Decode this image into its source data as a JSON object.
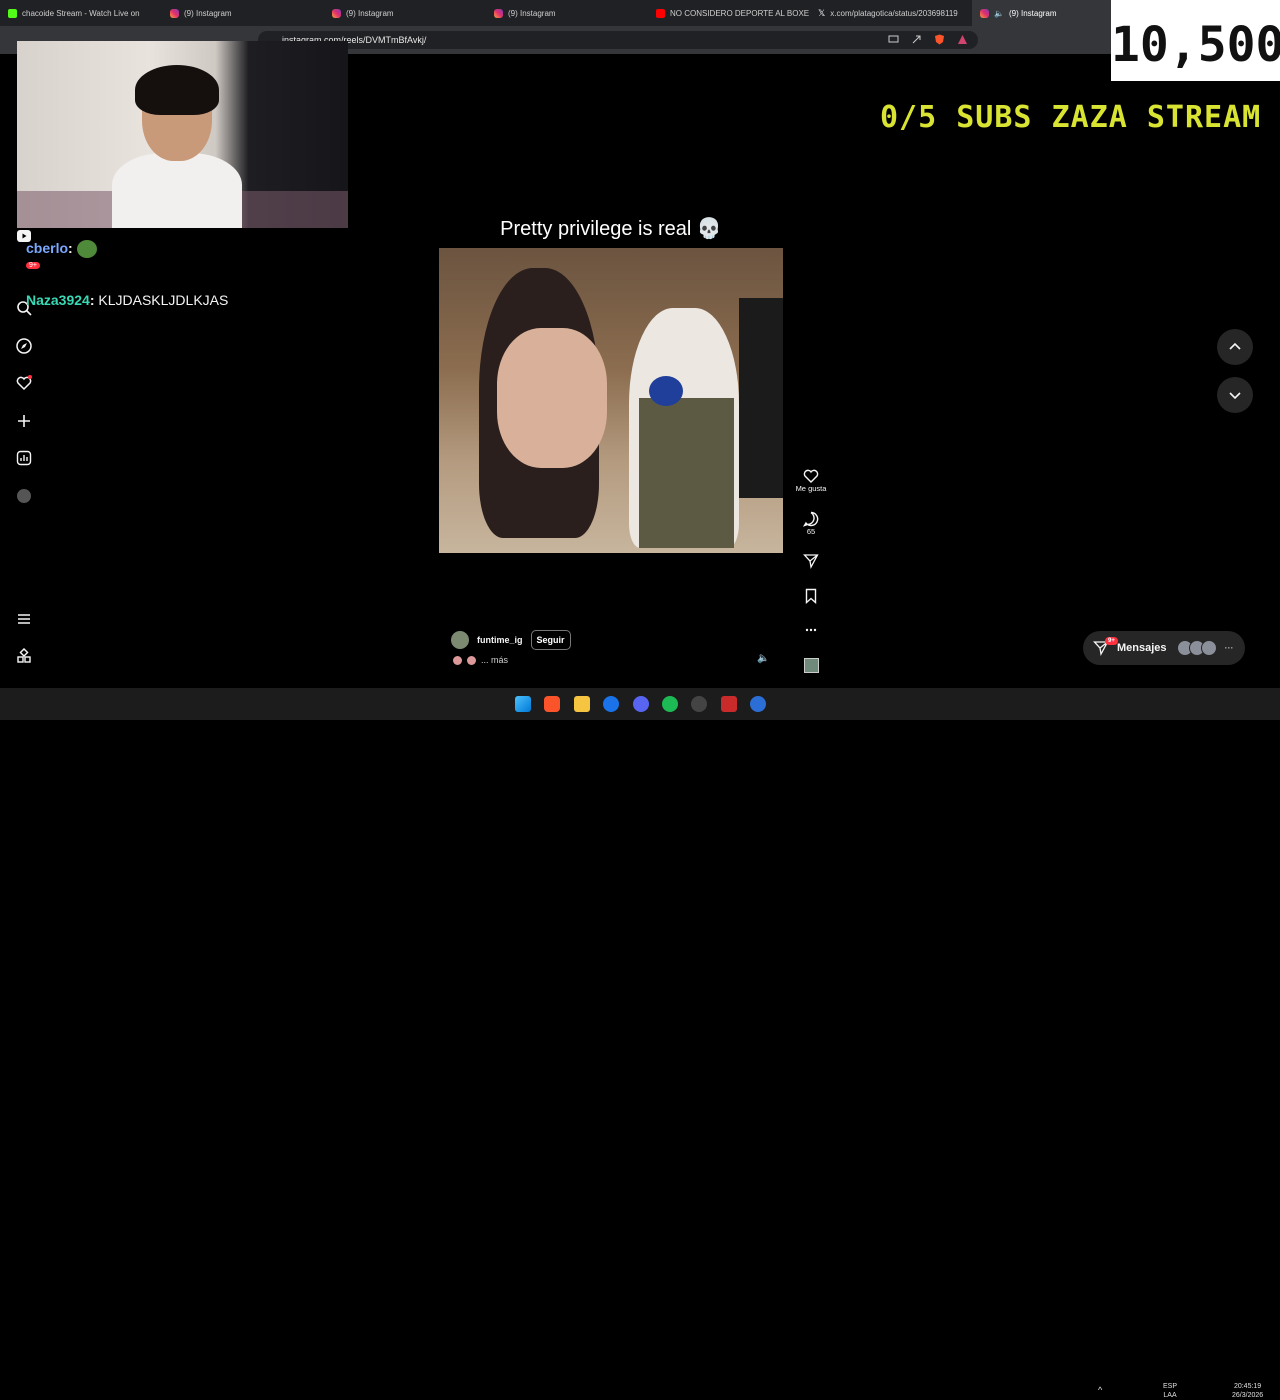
{
  "browser": {
    "tabs": [
      {
        "label": "chacoide Stream - Watch Live on",
        "icon": "kick-icon"
      },
      {
        "label": "(9) Instagram",
        "icon": "instagram-icon"
      },
      {
        "label": "(9) Instagram",
        "icon": "instagram-icon"
      },
      {
        "label": "(9) Instagram",
        "icon": "instagram-icon"
      },
      {
        "label": "NO CONSIDERO DEPORTE AL BOXE",
        "icon": "youtube-icon"
      },
      {
        "label": "x.com/platagotica/status/203698119",
        "icon": "x-icon"
      },
      {
        "label": "(9) Instagram",
        "icon": "instagram-icon"
      }
    ],
    "url": "instagram.com/reels/DVMTmBfAvkj/"
  },
  "overlay": {
    "counter": "10,500",
    "subs_goal": "0/5 SUBS ZAZA STREAM"
  },
  "chat": {
    "messages": [
      {
        "user": "cberlo",
        "text": ""
      },
      {
        "user": "Naza3924",
        "text": "KLJDASKLJDLKJAS"
      }
    ],
    "user_colors": {
      "cberlo": "#7aa8ff",
      "Naza3924": "#38d9b5"
    },
    "badge": "9+"
  },
  "reel": {
    "caption": "Pretty privilege is real 💀",
    "author": "funtime_ig",
    "follow_label": "Seguir",
    "more_label": "... más",
    "like_label": "Me gusta",
    "comment_count": "65"
  },
  "messages_button": {
    "label": "Mensajes",
    "badge": "9+"
  },
  "taskbar": {
    "lang_top": "ESP",
    "lang_bottom": "LAA",
    "time": "20:45:19",
    "date": "26/3/2026"
  }
}
